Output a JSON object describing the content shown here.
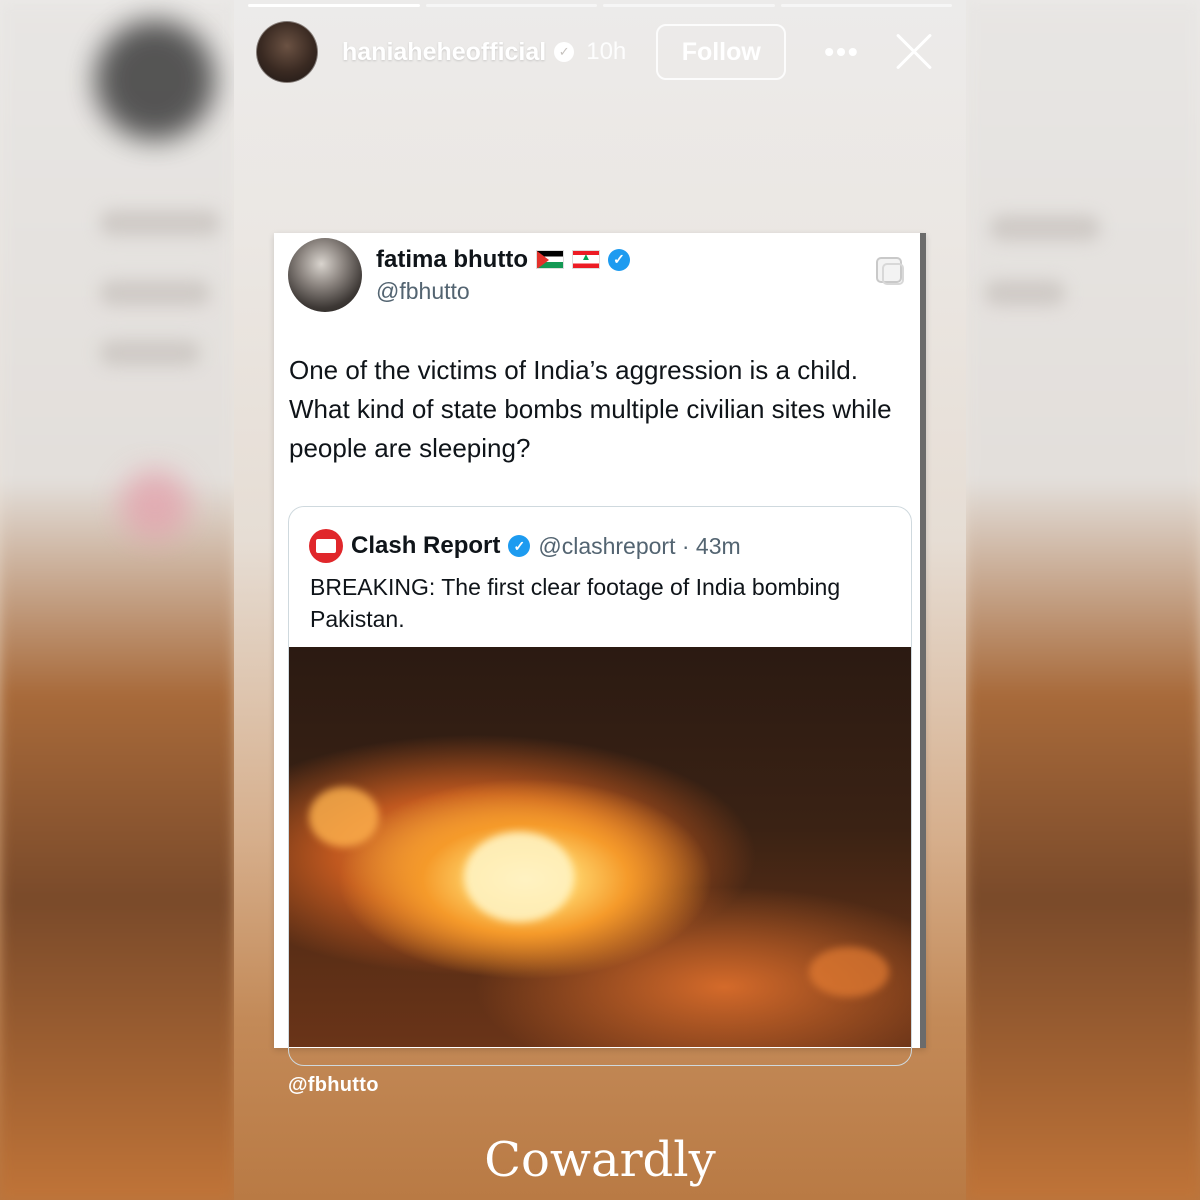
{
  "story": {
    "header": {
      "username": "haniaheheofficial",
      "time": "10h",
      "follow_label": "Follow",
      "more_label": "•••"
    },
    "progress": {
      "segments": 4,
      "current": 1
    }
  },
  "tweet": {
    "author_name": "fatima bhutto",
    "author_handle": "@fbhutto",
    "text": "One of the victims of India’s aggression is a child. What kind of state bombs multiple civilian sites while people are sleeping?",
    "quoted": {
      "author_name": "Clash Report",
      "author_handle": "@clashreport · 43m",
      "text": "BREAKING: The first clear footage of India bombing Pakistan."
    }
  },
  "mention": "@fbhutto",
  "caption": "Cowardly",
  "icons": {
    "verified": "verified-badge-icon",
    "more": "more-dots-icon",
    "close": "close-icon",
    "copy": "copy-icon"
  },
  "colors": {
    "accent_blue": "#1d9bf0",
    "clash_red": "#e0272b"
  }
}
